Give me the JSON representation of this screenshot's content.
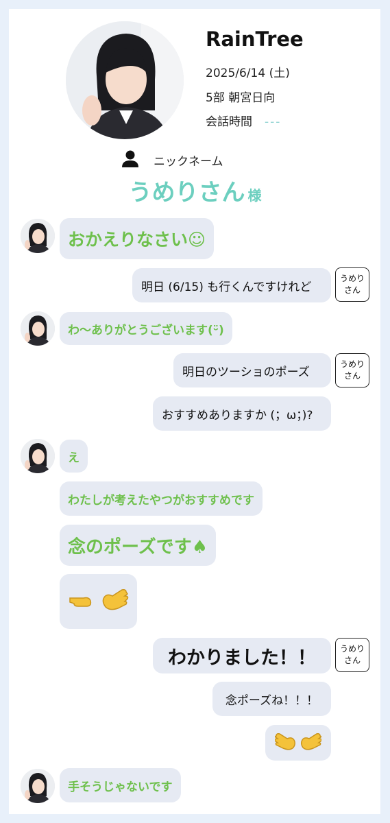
{
  "header": {
    "talent_name": "RainTree",
    "date": "2025/6/14 (土)",
    "session": "5部  朝宮日向",
    "time_label": "会話時間",
    "time_value": "---",
    "nickname_label": "ニックネーム",
    "nickname": "うめりさん",
    "nickname_suffix": "様"
  },
  "tag_label_line1": "うめり",
  "tag_label_line2": "さん",
  "messages": {
    "m1": "おかえりなさい☺",
    "m2": "明日 (6/15) も行くんですけれど",
    "m3": "わ〜ありがとうございます(ᵕ̈)",
    "m4": "明日のツーショのポーズ",
    "m5": "おすすめありますか (；ω；)?",
    "m6": "え",
    "m7": "わたしが考えたやつがおすすめです",
    "m8": "念のポーズです♠",
    "m9": "",
    "m10": "わかりました！！",
    "m11": "念ポーズね！！！",
    "m12": "",
    "m13": "手そうじゃないです"
  },
  "colors": {
    "background": "#e8f0fa",
    "bubble": "#e6eaf3",
    "incoming_text": "#6ec04c",
    "nickname": "#6ccfbf"
  },
  "icons": [
    "person-icon",
    "pointing-hand-icon",
    "open-hand-icon",
    "spade-icon"
  ]
}
